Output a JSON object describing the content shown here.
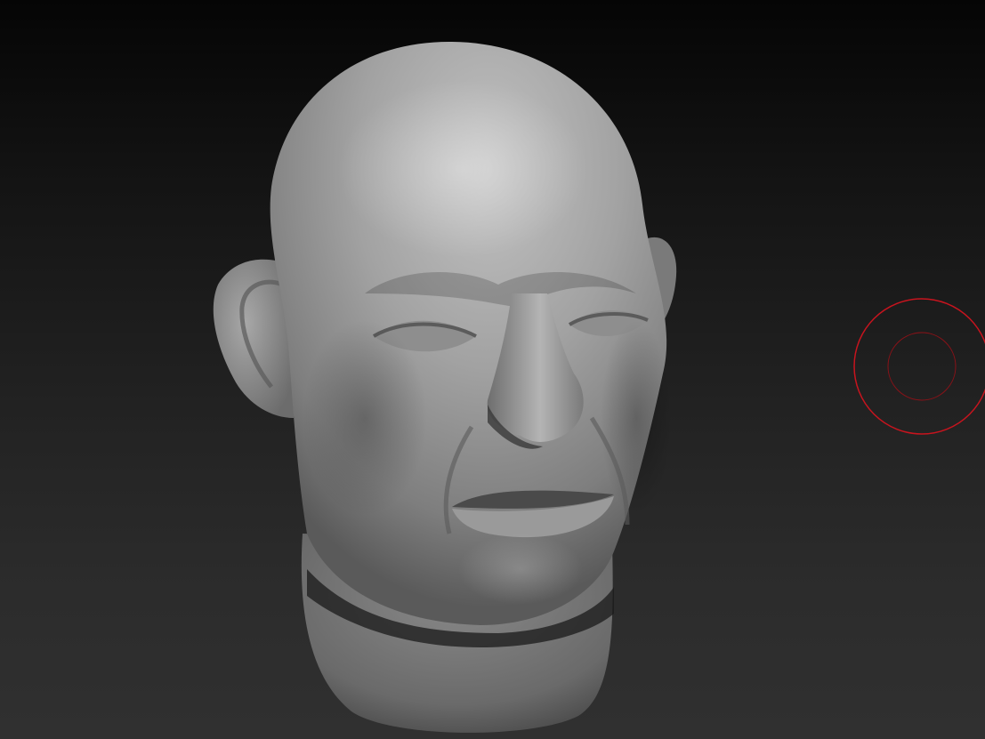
{
  "app": {
    "view": "3d-sculpting-viewport"
  },
  "viewport": {
    "background_top": "#050505",
    "background_bottom": "#303030"
  },
  "model": {
    "subject": "sculpted-human-head",
    "material_color": "#8c8c8c"
  },
  "brush": {
    "cursor_color": "#c8141e",
    "icon": "brush-cursor-icon"
  }
}
